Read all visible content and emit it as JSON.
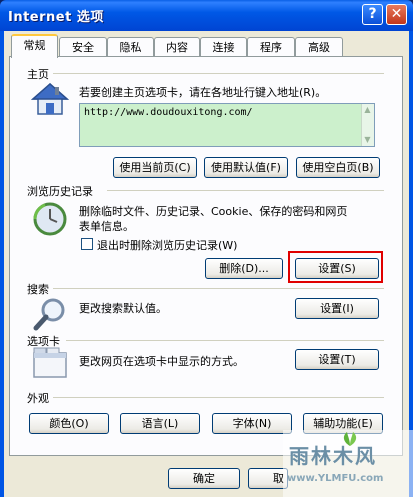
{
  "window": {
    "title": "Internet 选项",
    "help": "?",
    "close": "✕"
  },
  "tabs": [
    "常规",
    "安全",
    "隐私",
    "内容",
    "连接",
    "程序",
    "高级"
  ],
  "home": {
    "heading": "主页",
    "description": "若要创建主页选项卡，请在各地址行键入地址(R)。",
    "url": "http://www.doudouxitong.com/",
    "buttons": {
      "use_current": "使用当前页(C)",
      "use_default": "使用默认值(F)",
      "use_blank": "使用空白页(B)"
    }
  },
  "history": {
    "heading": "浏览历史记录",
    "description_line1": "删除临时文件、历史记录、Cookie、保存的密码和网页",
    "description_line2": "表单信息。",
    "checkbox_label": "退出时删除浏览历史记录(W)",
    "checkbox_checked": false,
    "buttons": {
      "delete": "删除(D)...",
      "settings": "设置(S)"
    }
  },
  "search": {
    "heading": "搜索",
    "description": "更改搜索默认值。",
    "settings_button": "设置(I)"
  },
  "tabs_section": {
    "heading": "选项卡",
    "description": "更改网页在选项卡中显示的方式。",
    "settings_button": "设置(T)"
  },
  "appearance": {
    "heading": "外观",
    "buttons": {
      "colors": "颜色(O)",
      "languages": "语言(L)",
      "fonts": "字体(N)",
      "accessibility": "辅助功能(E)"
    }
  },
  "footer": {
    "ok": "确定",
    "cancel": "取"
  },
  "watermark": {
    "text": "雨林木风",
    "url": "www.YLMFU.com"
  },
  "colors": {
    "highlight": "#e00000",
    "title_bar": "#0058e6",
    "url_field_bg": "#ccf0cc"
  }
}
